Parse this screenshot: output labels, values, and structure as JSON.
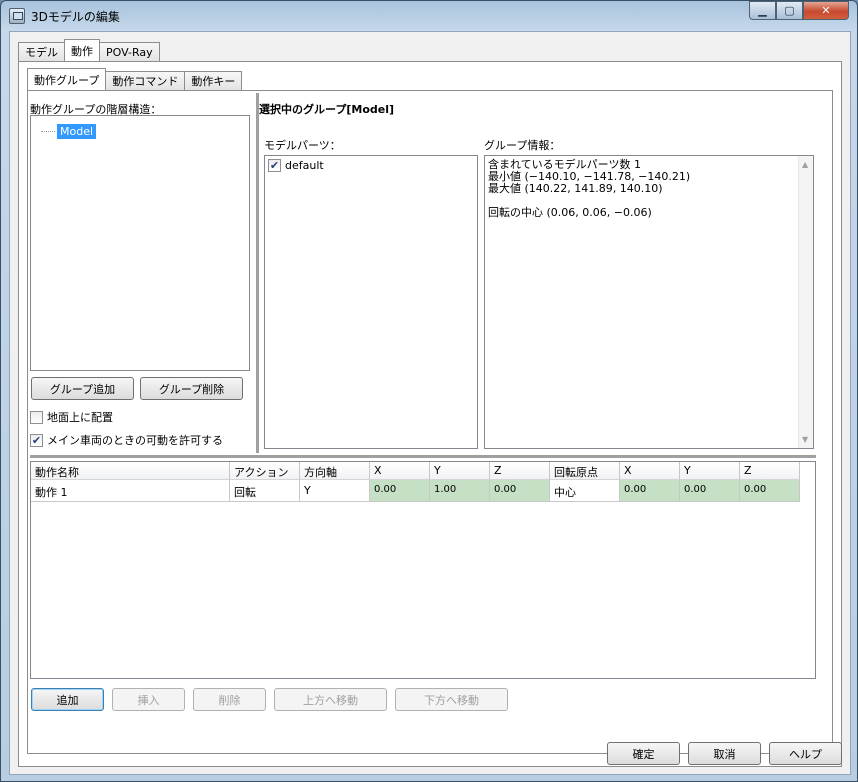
{
  "window": {
    "title": "3Dモデルの編集"
  },
  "main_tabs": [
    "モデル",
    "動作",
    "POV-Ray"
  ],
  "sub_tabs": [
    "動作グループ",
    "動作コマンド",
    "動作キー"
  ],
  "left": {
    "tree_label": "動作グループの階層構造：",
    "tree_node": "Model",
    "add_group": "グループ追加",
    "delete_group": "グループ削除",
    "place_on_ground": {
      "label": "地面上に配置",
      "checked": false
    },
    "allow_main_vehicle": {
      "label": "メイン車両のときの可動を許可する",
      "checked": true
    }
  },
  "right": {
    "selected_title": "選択中のグループ[Model]",
    "parts_label": "モデルパーツ：",
    "parts": [
      {
        "label": "default",
        "checked": true
      }
    ],
    "info_label": "グループ情報：",
    "info_lines": [
      "含まれているモデルパーツ数  1",
      "最小値 (−140.10, −141.78, −140.21)",
      "最大値 (140.22, 141.89, 140.10)",
      "",
      "回転の中心 (0.06, 0.06, −0.06)"
    ]
  },
  "grid": {
    "headers": [
      "動作名称",
      "アクション",
      "方向軸",
      "X",
      "Y",
      "Z",
      "回転原点",
      "X",
      "Y",
      "Z"
    ],
    "rows": [
      [
        "動作 1",
        "回転",
        "Y",
        "0.00",
        "1.00",
        "0.00",
        "中心",
        "0.00",
        "0.00",
        "0.00"
      ]
    ]
  },
  "grid_buttons": [
    "追加",
    "挿入",
    "削除",
    "上方へ移動",
    "下方へ移動"
  ],
  "footer_buttons": [
    "確定",
    "取消",
    "ヘルプ"
  ]
}
